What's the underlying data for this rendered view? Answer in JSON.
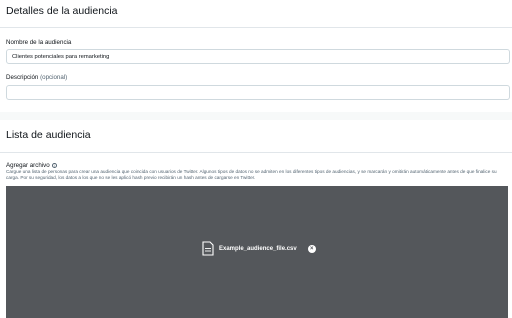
{
  "details": {
    "title": "Detalles de la audiencia",
    "name_label": "Nombre de la audiencia",
    "name_value": "Clientes potenciales para remarketing",
    "description_label": "Descripción",
    "description_optional": "(opcional)",
    "description_value": ""
  },
  "audience_list": {
    "title": "Lista de audiencia",
    "upload_label": "Agregar archivo",
    "upload_help": "Cargue una lista de personas para crear una audiencia que coincida con usuarios de Twitter. Algunos tipos de datos no se admiten en los diferentes tipos de audiencias, y se marcarán y omitirán automáticamente antes de que finalice su carga. Por su seguridad, los datos a los que no se les aplicó hash previo recibirán un hash antes de cargarse en Twitter.",
    "file_name": "Example_audience_file.csv",
    "remove_symbol": "×"
  },
  "icons": {
    "info": "info-icon",
    "file": "document-icon",
    "remove": "close-icon"
  },
  "colors": {
    "dropzone_bg": "#54575b",
    "text_primary": "#0f1419",
    "text_secondary": "#536471"
  }
}
